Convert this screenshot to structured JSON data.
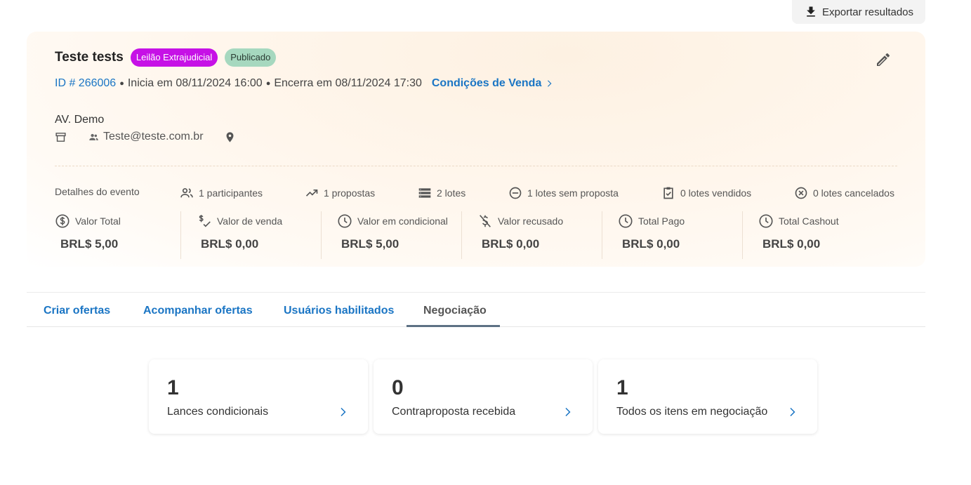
{
  "export": {
    "label": "Exportar resultados",
    "icon": "download-icon"
  },
  "event": {
    "title": "Teste tests",
    "badges": [
      "Leilão Extrajudicial",
      "Publicado"
    ],
    "id_text": "ID # 266006",
    "starts": "Inicia em 08/11/2024 16:00",
    "ends": "Encerra em 08/11/2024 17:30",
    "conditions_link": "Condições de Venda",
    "org_name": "AV. Demo",
    "contact_email": "Teste@teste.com.br"
  },
  "stats": {
    "title": "Detalhes do evento",
    "participants": "1 participantes",
    "proposals": "1 propostas",
    "lots": "2 lotes",
    "lots_no_proposal": "1 lotes sem proposta",
    "lots_sold": "0 lotes vendidos",
    "lots_cancelled": "0 lotes cancelados"
  },
  "values": [
    {
      "label": "Valor Total",
      "amount": "BRL$ 5,00",
      "icon": "dollar-circle-icon"
    },
    {
      "label": "Valor de venda",
      "amount": "BRL$ 0,00",
      "icon": "price-check-icon"
    },
    {
      "label": "Valor em condicional",
      "amount": "BRL$ 5,00",
      "icon": "clock-icon"
    },
    {
      "label": "Valor recusado",
      "amount": "BRL$ 0,00",
      "icon": "money-off-icon"
    },
    {
      "label": "Total Pago",
      "amount": "BRL$ 0,00",
      "icon": "clock-icon"
    },
    {
      "label": "Total Cashout",
      "amount": "BRL$ 0,00",
      "icon": "clock-icon"
    }
  ],
  "tabs": [
    {
      "label": "Criar ofertas"
    },
    {
      "label": "Acompanhar ofertas"
    },
    {
      "label": "Usuários habilitados"
    },
    {
      "label": "Negociação",
      "active": true
    }
  ],
  "negotiation": [
    {
      "count": "1",
      "label": "Lances condicionais"
    },
    {
      "count": "0",
      "label": "Contraproposta recebida"
    },
    {
      "count": "1",
      "label": "Todos os itens em negociação"
    }
  ],
  "colors": {
    "accent": "#1a75c4",
    "badge_purple": "#c611e6",
    "badge_green": "#a6d8bf"
  }
}
